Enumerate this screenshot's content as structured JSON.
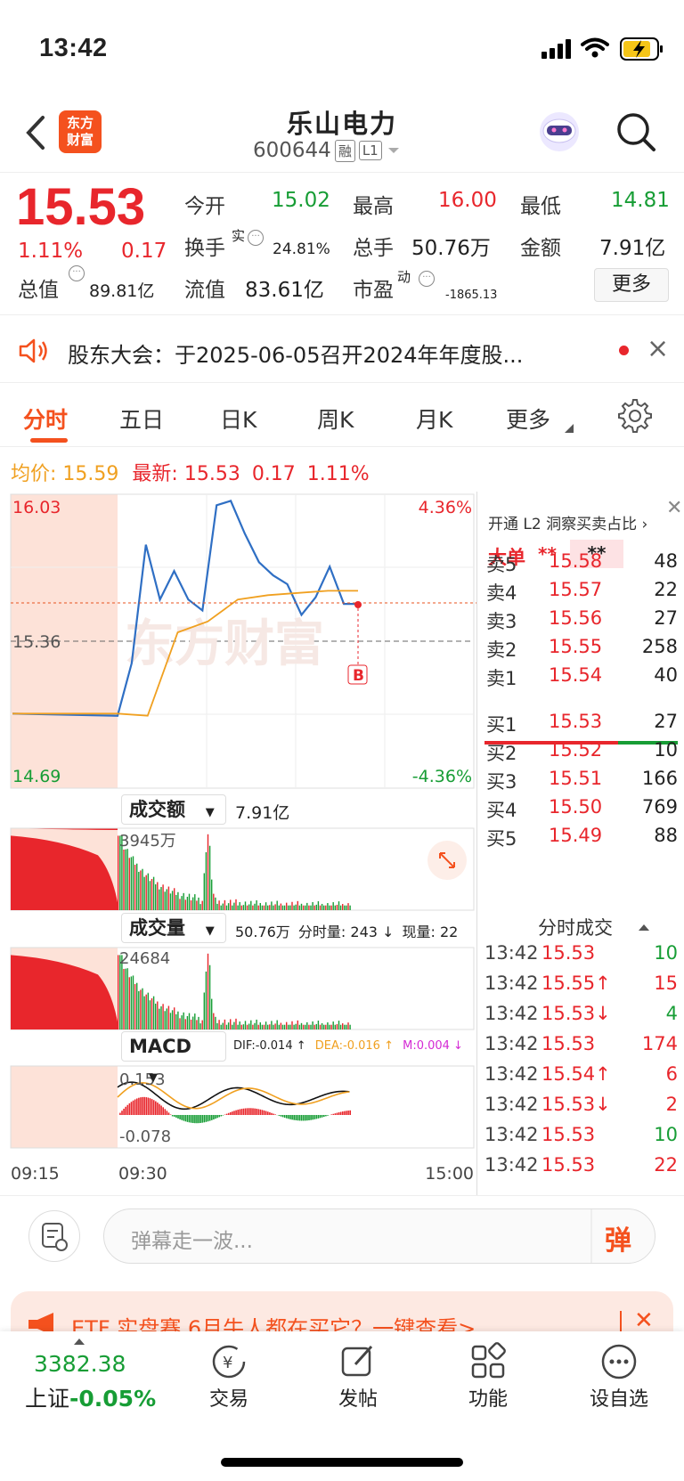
{
  "status_bar": {
    "time": "13:42"
  },
  "nav": {
    "back_icon": "chevron-left-icon",
    "logo": "东方\n财富",
    "title": "乐山电力",
    "code": "600644",
    "tag1": "融",
    "tag2": "L1"
  },
  "quote": {
    "price": "15.53",
    "pct": "1.11%",
    "change": "0.17",
    "open_label": "今开",
    "open": "15.02",
    "high_label": "最高",
    "high": "16.00",
    "low_label": "最低",
    "low": "14.81",
    "turnover_label": "换手",
    "turnover_sup": "实",
    "turnover": "24.81%",
    "vol_label": "总手",
    "vol": "50.76万",
    "amount_label": "金额",
    "amount": "7.91亿",
    "mcap_label": "总值",
    "mcap": "89.81亿",
    "float_label": "流值",
    "float": "83.61亿",
    "pe_label": "市盈",
    "pe_sup": "动",
    "pe": "-1865.13",
    "more": "更多"
  },
  "notice": {
    "text": "股东大会：于2025-06-05召开2024年年度股...",
    "close": "×"
  },
  "tabs": [
    "分时",
    "五日",
    "日K",
    "周K",
    "月K",
    "更多"
  ],
  "avg": {
    "avg_label": "均价:",
    "avg": "15.59",
    "last_label": "最新:",
    "last": "15.53",
    "chg": "0.17",
    "pct": "1.11%"
  },
  "chart": {
    "y_top": "16.03",
    "y_mid": "15.36",
    "y_bot": "14.69",
    "pct_top": "4.36%",
    "pct_bot": "-4.36%",
    "marker": "B",
    "watermark": "东方财富",
    "amount_label": "成交额",
    "amount_val": "7.91亿",
    "amount_max": "3945万",
    "vol_label": "成交量",
    "vol_val": "50.76万",
    "vol_min": "分时量: 243 ↓",
    "vol_now": "现量: 22",
    "vol_max": "24684",
    "macd_label": "MACD",
    "dif": "DIF:-0.014 ↑",
    "dea": "DEA:-0.016 ↑",
    "m": "M:0.004 ↓",
    "macd_top": "0.153",
    "macd_bot": "-0.078",
    "t_start": "09:15",
    "t_open": "09:30",
    "t_end": "15:00"
  },
  "chart_data": {
    "type": "line",
    "title": "",
    "ylim": [
      14.69,
      16.03
    ],
    "x": [
      "09:15",
      "09:30",
      "15:00"
    ],
    "series": [
      {
        "name": "最新",
        "values": [
          15.03,
          15.02,
          15.26,
          15.8,
          15.55,
          15.68,
          15.55,
          15.5,
          15.98,
          16.0,
          15.85,
          15.72,
          15.66,
          15.62,
          15.48,
          15.56,
          15.7,
          15.53,
          15.53
        ]
      },
      {
        "name": "均价",
        "values": [
          15.03,
          15.03,
          15.02,
          15.4,
          15.45,
          15.55,
          15.57,
          15.58,
          15.59,
          15.59
        ]
      }
    ]
  },
  "book": {
    "l2_label": "开通 L2 洞察买卖占比 ›",
    "big_label": "大单",
    "big1": "**",
    "big2": "**",
    "sells": [
      {
        "l": "卖5",
        "p": "15.58",
        "v": "48"
      },
      {
        "l": "卖4",
        "p": "15.57",
        "v": "22"
      },
      {
        "l": "卖3",
        "p": "15.56",
        "v": "27"
      },
      {
        "l": "卖2",
        "p": "15.55",
        "v": "258"
      },
      {
        "l": "卖1",
        "p": "15.54",
        "v": "40"
      }
    ],
    "buys": [
      {
        "l": "买1",
        "p": "15.53",
        "v": "27"
      },
      {
        "l": "买2",
        "p": "15.52",
        "v": "10"
      },
      {
        "l": "买3",
        "p": "15.51",
        "v": "166"
      },
      {
        "l": "买4",
        "p": "15.50",
        "v": "769"
      },
      {
        "l": "买5",
        "p": "15.49",
        "v": "88"
      }
    ],
    "ticks_label": "分时成交",
    "ticks": [
      {
        "t": "13:42",
        "p": "15.53",
        "v": "10"
      },
      {
        "t": "13:42",
        "p": "15.55↑",
        "v": "15"
      },
      {
        "t": "13:42",
        "p": "15.53↓",
        "v": "4"
      },
      {
        "t": "13:42",
        "p": "15.53",
        "v": "174"
      },
      {
        "t": "13:42",
        "p": "15.54↑",
        "v": "6"
      },
      {
        "t": "13:42",
        "p": "15.53↓",
        "v": "2"
      },
      {
        "t": "13:42",
        "p": "15.53",
        "v": "10"
      },
      {
        "t": "13:42",
        "p": "15.53",
        "v": "22"
      }
    ]
  },
  "danmu": {
    "placeholder": "弹幕走一波...",
    "btn": "弹"
  },
  "ad": {
    "text": "ETF 实盘赛 6月牛人都在买它？一键查看>"
  },
  "bottom": {
    "index_val": "3382.38",
    "index_name": "上证",
    "index_pct": "-0.05%",
    "trade": "交易",
    "post": "发帖",
    "func": "功能",
    "watch": "设自选"
  }
}
